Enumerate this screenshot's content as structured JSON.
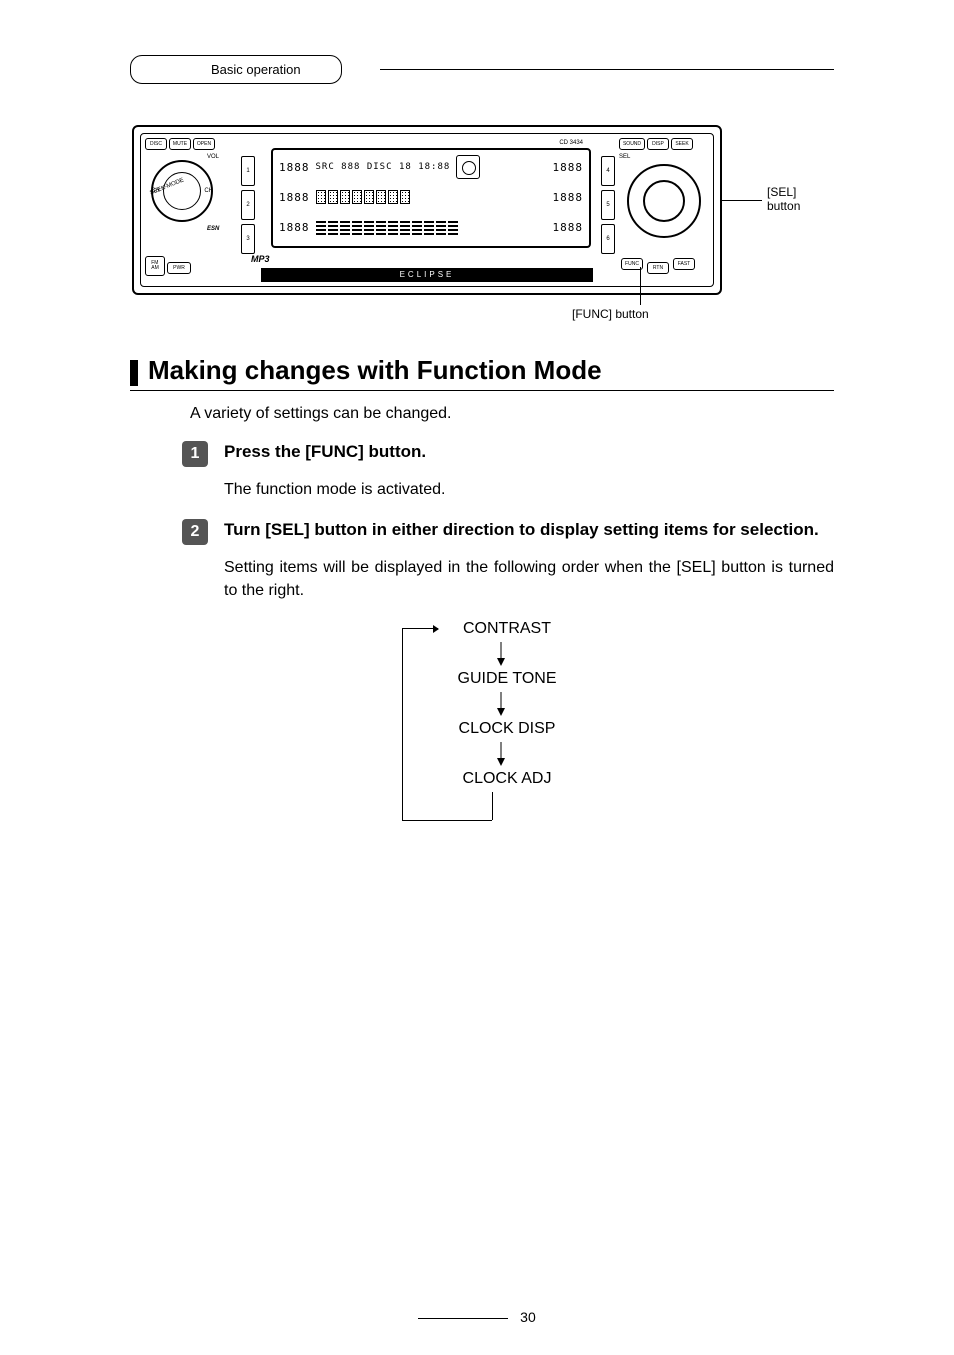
{
  "header": {
    "tab_label": "Basic operation"
  },
  "diagram": {
    "model": "CD 3434",
    "brand": "ECLIPSE",
    "left": {
      "btn_disc": "DISC",
      "btn_mute": "MUTE",
      "btn_open": "OPEN",
      "vol": "VOL",
      "seek_mode": "SEEK-MODE",
      "ch_l": "CH",
      "ch_r": "CH",
      "esn": "ESN",
      "fm_am": "FM\nAM",
      "pwr": "PWR",
      "mp3": "MP3"
    },
    "presets_left": [
      "1",
      "2",
      "3"
    ],
    "presets_right": [
      "4",
      "5",
      "6"
    ],
    "screen": {
      "row1_seg_l": "1888",
      "row1_mid": "SRC 888 DISC 18  18:88",
      "row1_seg_r": "1888",
      "row2_seg_l": "1888",
      "row2_seg_r": "1888",
      "row3_seg_l": "1888",
      "row3_seg_r": "1888"
    },
    "right": {
      "sound": "SOUND",
      "disp": "DISP",
      "seek": "SEEK",
      "sel": "SEL",
      "func": "FUNC",
      "rtn": "RTN",
      "fast": "FAST"
    },
    "callouts": {
      "sel": "[SEL]\nbutton",
      "func": "[FUNC] button"
    }
  },
  "title": "Making changes with Function Mode",
  "intro": "A variety of settings can be changed.",
  "steps": [
    {
      "num": "1",
      "instr": "Press the [FUNC] button.",
      "detail": "The function mode is activated."
    },
    {
      "num": "2",
      "instr": "Turn [SEL] button in either direction to display setting items for selection.",
      "detail": "Setting items will be displayed in the following order when the [SEL] button is turned to the right."
    }
  ],
  "flow": [
    "CONTRAST",
    "GUIDE TONE",
    "CLOCK DISP",
    "CLOCK ADJ"
  ],
  "page_number": "30"
}
